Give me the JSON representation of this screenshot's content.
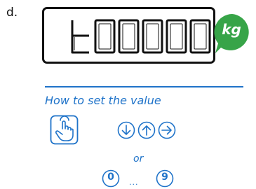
{
  "step_label": "d.",
  "display": {
    "value": "t00000",
    "unit": "kg"
  },
  "instructions": {
    "title": "How to set the value",
    "or_label": "or",
    "keys": [
      "0",
      "9"
    ],
    "ellipsis": "..."
  },
  "icons": {
    "press": "hand-press-icon",
    "down": "arrow-down-icon",
    "up": "arrow-up-icon",
    "right": "arrow-right-icon"
  },
  "colors": {
    "accent_blue": "#1f73c9",
    "badge_green": "#37a448",
    "outline": "#111111"
  }
}
